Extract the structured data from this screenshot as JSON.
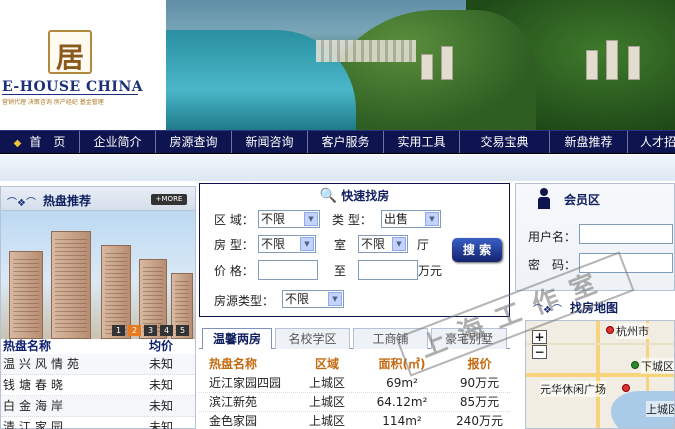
{
  "brand": {
    "logo_text": "E-HOUSE CHINA",
    "tagline": "营销代理  决策咨询  房产经纪  基金管理",
    "logo_glyph": "易居"
  },
  "nav": {
    "items": [
      "首　页",
      "企业简介",
      "房源查询",
      "新闻咨询",
      "客户服务",
      "实用工具",
      "交易宝典",
      "新盘推荐",
      "人才招"
    ]
  },
  "hot": {
    "title": "热盘推荐",
    "more_label": "MORE",
    "pager": [
      "1",
      "2",
      "3",
      "4",
      "5"
    ],
    "active_page": "2",
    "col_name": "热盘名称",
    "col_price": "均价",
    "rows": [
      {
        "name": "温兴风情苑",
        "price": "未知"
      },
      {
        "name": "钱塘春晓",
        "price": "未知"
      },
      {
        "name": "白金海岸",
        "price": "未知"
      },
      {
        "name": "清江家园",
        "price": "未知"
      }
    ]
  },
  "quick_search": {
    "title": "快速找房",
    "area_label": "区 域：",
    "area_value": "不限",
    "type_label": "类 型：",
    "type_value": "出售",
    "house_label": "房 型：",
    "house_value": "不限",
    "room_label": "室",
    "room_value": "不限",
    "hall_label": "厅",
    "price_label": "价 格：",
    "price_to": "至",
    "price_unit": "万元",
    "source_label": "房源类型：",
    "source_value": "不限",
    "submit_label": "搜 索"
  },
  "tabs": [
    "温馨两房",
    "名校学区",
    "工商铺",
    "豪宅别墅"
  ],
  "listings": {
    "headers": [
      "热盘名称",
      "区域",
      "面积(㎡)",
      "报价"
    ],
    "rows": [
      {
        "name": "近江家园四园",
        "district": "上城区",
        "area": "69m²",
        "price": "90万元"
      },
      {
        "name": "滨江新苑",
        "district": "上城区",
        "area": "64.12m²",
        "price": "85万元"
      },
      {
        "name": "金色家园",
        "district": "上城区",
        "area": "114m²",
        "price": "240万元"
      }
    ]
  },
  "member": {
    "title": "会员区",
    "username_label": "用户名：",
    "password_label": "密　码："
  },
  "map_section": {
    "title": "找房地图",
    "labels": [
      "杭州市",
      "下城区",
      "元华休闲广场",
      "上城区"
    ]
  },
  "watermark_text": "上海工作室"
}
